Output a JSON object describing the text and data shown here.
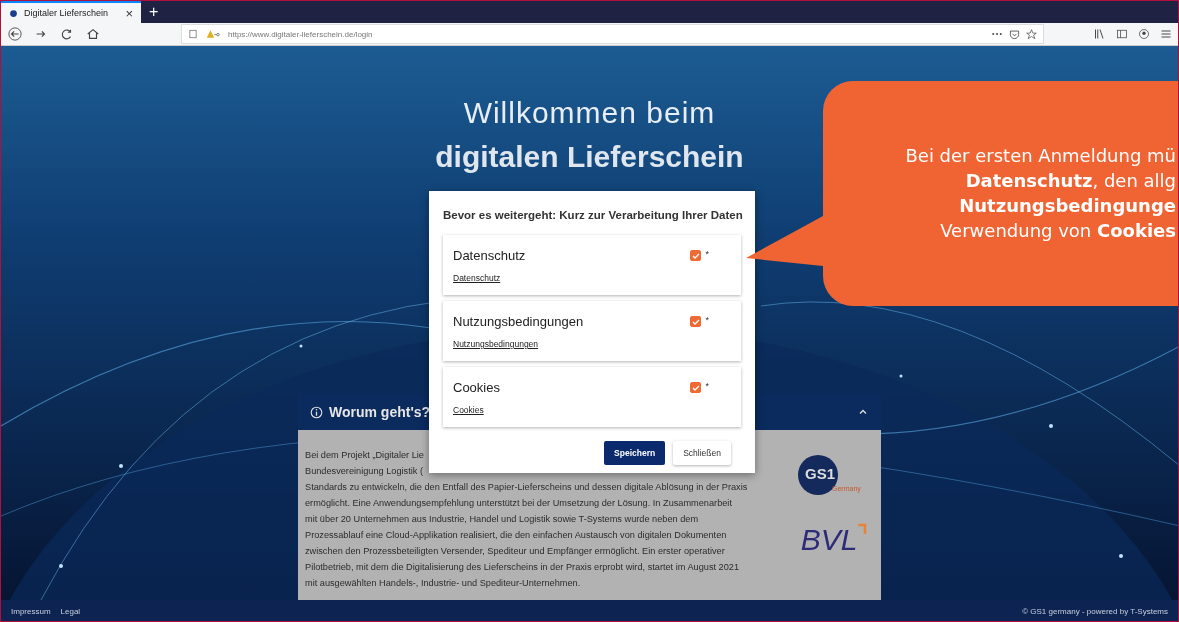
{
  "browser": {
    "tab": {
      "title": "Digitaler Lieferschein",
      "close": "×",
      "selected": true
    },
    "new_tab": "+",
    "url": "https://www.digitaler-lieferschein.de/login"
  },
  "hero": {
    "line_1": "Willkommen beim",
    "line_2": "digitalen Lieferschein"
  },
  "dialog": {
    "title": "Bevor es weitergeht: Kurz zur Verarbeitung Ihrer Daten",
    "items": [
      {
        "title": "Datenschutz",
        "link": "Datenschutz",
        "checked": true,
        "required_mark": "*"
      },
      {
        "title": "Nutzungsbedingungen",
        "link": "Nutzungsbedingungen",
        "checked": true,
        "required_mark": "*"
      },
      {
        "title": "Cookies",
        "link": "Cookies",
        "checked": true,
        "required_mark": "*"
      }
    ],
    "buttons": [
      {
        "label": "Speichern",
        "kind": "primary"
      },
      {
        "label": "Schließen",
        "kind": "secondary"
      }
    ]
  },
  "info_panel": {
    "title": "Worum geht's?",
    "expanded": true,
    "lines": [
      "Bei dem Projekt „Digitaler Lie",
      "Bundesvereinigung Logistik (",
      "Standards zu entwickeln, die den Entfall des Papier-Lieferscheins und dessen digitale Ablösung in der Praxis",
      "ermöglicht. Eine Anwendungsempfehlung unterstützt bei der Umsetzung der Lösung. In Zusammenarbeit",
      "mit über 20 Unternehmen aus Industrie, Handel und Logistik sowie T-Systems wurde neben dem",
      "Prozessablauf eine Cloud-Applikation realisiert, die den einfachen Austausch von digitalen Dokumenten",
      "zwischen den Prozessbeteiligten Versender, Spediteur und Empfänger ermöglicht. Ein erster operativer",
      "Pilotbetrieb, mit dem die Digitalisierung des Lieferscheins in der Praxis erprobt wird, startet im August 2021",
      "mit ausgewählten Handels-, Industrie- und Spediteur-Unternehmen."
    ],
    "logos": [
      {
        "kind": "gs1",
        "text": "GS1",
        "subtext": "Germany"
      },
      {
        "kind": "bvl",
        "text": "BVL"
      }
    ]
  },
  "footer": {
    "links": [
      "Impressum",
      "Legal"
    ],
    "credit": "© GS1 germany - powered by T-Systems"
  },
  "callout": {
    "lines": [
      "Bei der ersten Anmeldung mü",
      "**Datenschutz**, den allg",
      "**Nutzungsbedingunge**",
      "Verwendung von **Cookies**"
    ]
  }
}
